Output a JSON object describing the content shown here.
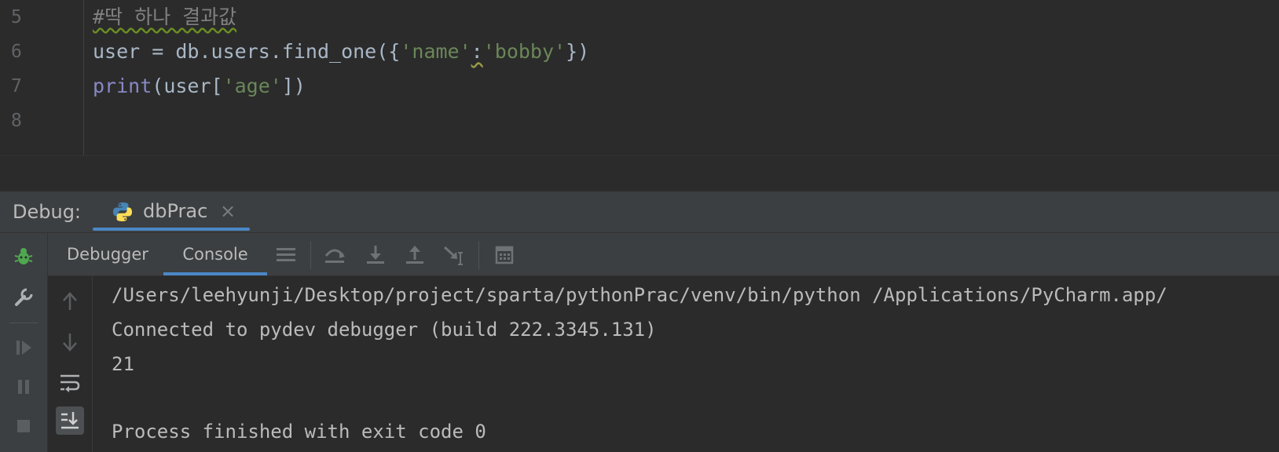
{
  "editor": {
    "lines": [
      {
        "number": "5",
        "segments": [
          {
            "text": "#딱 하나 결과값",
            "type": "comment"
          }
        ]
      },
      {
        "number": "6",
        "segments": [
          {
            "text": "user = db.users.find_one({",
            "type": "plain"
          },
          {
            "text": "'name'",
            "type": "string"
          },
          {
            "text": ":",
            "type": "warn"
          },
          {
            "text": "'bobby'",
            "type": "string"
          },
          {
            "text": "})",
            "type": "plain"
          }
        ]
      },
      {
        "number": "7",
        "segments": [
          {
            "text": "print",
            "type": "builtin"
          },
          {
            "text": "(user[",
            "type": "plain"
          },
          {
            "text": "'age'",
            "type": "string"
          },
          {
            "text": "])",
            "type": "plain"
          }
        ]
      },
      {
        "number": "8",
        "segments": []
      }
    ]
  },
  "debug": {
    "label": "Debug:",
    "tab": {
      "name": "dbPrac",
      "close": "×",
      "icon": "python-icon"
    },
    "subtabs": {
      "debugger": "Debugger",
      "console": "Console",
      "active": "Console"
    },
    "console_lines": [
      "/Users/leehyunji/Desktop/project/sparta/pythonPrac/venv/bin/python /Applications/PyCharm.app/",
      "Connected to pydev debugger (build 222.3345.131)",
      "21",
      "",
      "Process finished with exit code 0"
    ]
  },
  "colors": {
    "accent": "#4a88c7",
    "background": "#2b2b2b",
    "panel": "#3c3f41",
    "string": "#6a8759",
    "comment": "#808080",
    "builtin": "#8888c6",
    "bug_icon": "#4fa84f"
  }
}
